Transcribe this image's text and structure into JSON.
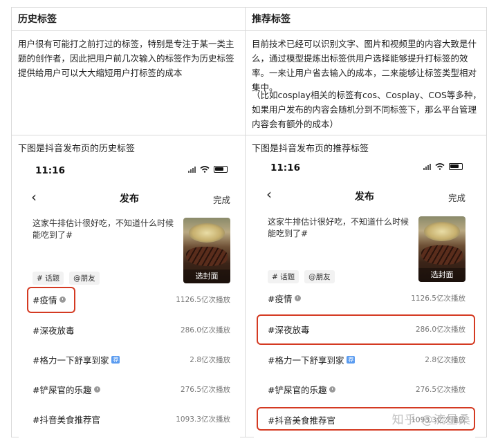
{
  "table": {
    "left_header": "历史标签",
    "right_header": "推荐标签",
    "left_text": "用户很有可能打之前打过的标签，特别是专注于某一类主题的创作者，因此把用户前几次输入的标签作为历史标签提供给用户可以大大缩短用户打标签的成本",
    "right_text_1": "目前技术已经可以识别文字、图片和视频里的内容大致是什么，通过模型提炼出标签供用户选择能够提升打标签的效率。一来让用户省去输入的成本，二来能够让标签类型相对集中。",
    "right_text_2": "（比如cosplay相关的标签有cos、Cosplay、COS等多种，如果用户发布的内容会随机分到不同标签下，那么平台管理内容会有额外的成本）",
    "left_section_title": "下图是抖音发布页的历史标签",
    "right_section_title": "下图是抖音发布页的推荐标签"
  },
  "phone_left": {
    "time": "11:16",
    "back_icon": "chevron-left-icon",
    "title": "发布",
    "done": "完成",
    "caption": "这家牛排估计很好吃，不知道什么时候能吃到了#",
    "cover_label": "选封面",
    "chips": [
      "# 话题",
      "@朋友"
    ],
    "tags": [
      {
        "name": "#疫情",
        "badge": "clock",
        "plays": "1126.5亿次播放"
      },
      {
        "name": "#深夜放毒",
        "badge": "",
        "plays": "286.0亿次播放"
      },
      {
        "name": "#格力一下舒享到家",
        "badge": "荐",
        "plays": "2.8亿次播放"
      },
      {
        "name": "#铲屎官的乐趣",
        "badge": "clock",
        "plays": "276.5亿次播放"
      },
      {
        "name": "#抖音美食推荐官",
        "badge": "",
        "plays": "1093.3亿次播放"
      }
    ]
  },
  "phone_right": {
    "time": "11:16",
    "back_icon": "chevron-left-icon",
    "title": "发布",
    "done": "完成",
    "caption": "这家牛排估计很好吃，不知道什么时候能吃到了#",
    "cover_label": "选封面",
    "chips": [
      "# 话题",
      "@朋友"
    ],
    "tags": [
      {
        "name": "#疫情",
        "badge": "clock",
        "plays": "1126.5亿次播放"
      },
      {
        "name": "#深夜放毒",
        "badge": "",
        "plays": "286.0亿次播放"
      },
      {
        "name": "#格力一下舒享到家",
        "badge": "荐",
        "plays": "2.8亿次播放"
      },
      {
        "name": "#铲屎官的乐趣",
        "badge": "clock",
        "plays": "276.5亿次播放"
      },
      {
        "name": "#抖音美食推荐官",
        "badge": "",
        "plays": "1093.3亿次播放"
      }
    ]
  },
  "watermark": "知乎 @流星桑",
  "colors": {
    "highlight": "#d43a22",
    "recommend_badge": "#5b9cf0"
  }
}
